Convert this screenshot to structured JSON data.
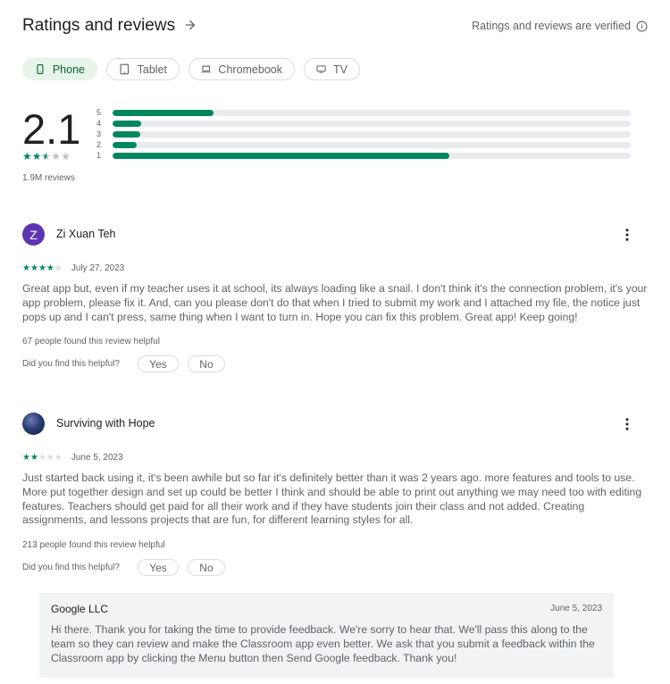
{
  "header": {
    "title": "Ratings and reviews",
    "verified": "Ratings and reviews are verified"
  },
  "device_tabs": [
    {
      "label": "Phone",
      "icon": "phone-icon",
      "selected": true
    },
    {
      "label": "Tablet",
      "icon": "tablet-icon",
      "selected": false
    },
    {
      "label": "Chromebook",
      "icon": "laptop-icon",
      "selected": false
    },
    {
      "label": "TV",
      "icon": "tv-icon",
      "selected": false
    }
  ],
  "summary": {
    "rating": "2.1",
    "stars_value": 2.5,
    "total_reviews": "1.9M reviews",
    "distribution": [
      {
        "label": "5",
        "fraction": 0.195
      },
      {
        "label": "4",
        "fraction": 0.055
      },
      {
        "label": "3",
        "fraction": 0.053
      },
      {
        "label": "2",
        "fraction": 0.047
      },
      {
        "label": "1",
        "fraction": 0.65
      }
    ]
  },
  "reviews": [
    {
      "name": "Zi Xuan Teh",
      "avatar_letter": "Z",
      "stars": 4,
      "date": "July 27, 2023",
      "text": "Great app but, even if my teacher uses it at school, its always loading like a snail. I don't think it's the connection problem, it's your app problem, please fix it. And, can you please don't do that when I tried to submit my work and I attached my file, the notice just pops up and I can't press, same thing when I want to turn in. Hope you can fix this problem. Great app! Keep going!",
      "helpful_count": "67 people found this review helpful",
      "helpful_question": "Did you find this helpful?",
      "yes_label": "Yes",
      "no_label": "No"
    },
    {
      "name": "Surviving with Hope",
      "avatar_letter": "",
      "stars": 2,
      "date": "June 5, 2023",
      "text": "Just started back using it, it's been awhile but so far it's definitely better than it was 2 years ago. more features and tools to use. More put together design and set up could be better I think and should be able to print out anything we may need too with editing features. Teachers should get paid for all their work and if they have students join their class and not added. Creating assignments, and lessons projects that are fun, for different learning styles for all.",
      "helpful_count": "213 people found this review helpful",
      "helpful_question": "Did you find this helpful?",
      "yes_label": "Yes",
      "no_label": "No",
      "developer_reply": {
        "name": "Google LLC",
        "date": "June 5, 2023",
        "text": "Hi there. Thank you for taking the time to provide feedback. We're sorry to hear that. We'll pass this along to the team so they can review and make the Classroom app even better. We ask that you submit a feedback within the Classroom app by clicking the Menu button then Send Google feedback. Thank you!"
      }
    }
  ],
  "colors": {
    "accent_green": "#01875f",
    "chip_selected_bg": "#e6f4ea",
    "avatar_purple": "#5e35b1"
  }
}
